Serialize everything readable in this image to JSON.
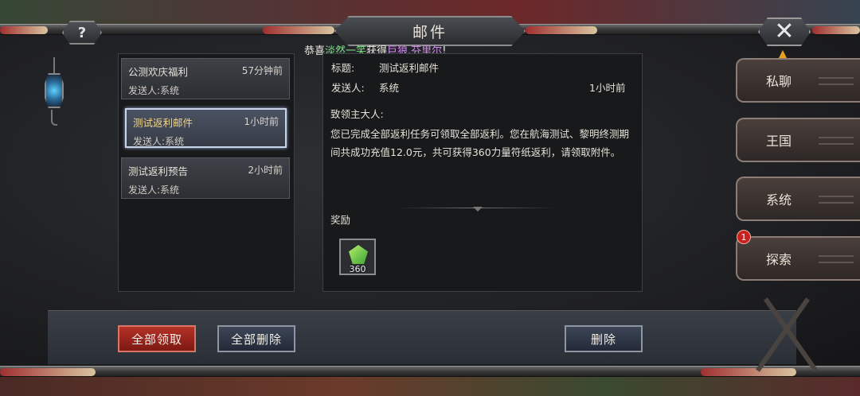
{
  "window": {
    "title": "邮件",
    "help_label": "?",
    "close_label": "✕"
  },
  "announcement": {
    "prefix": "恭喜",
    "player": "淡然一笑",
    "middle": "获得",
    "item": "巨狼.芬里尔",
    "suffix": "!"
  },
  "mail_list": [
    {
      "title": "公测欢庆福利",
      "time": "57分钟前",
      "sender": "发送人:系统",
      "selected": false
    },
    {
      "title": "测试返利邮件",
      "time": "1小时前",
      "sender": "发送人:系统",
      "selected": true
    },
    {
      "title": "测试返利预告",
      "time": "2小时前",
      "sender": "发送人:系统",
      "selected": false
    }
  ],
  "detail": {
    "subject_label": "标题:",
    "subject": "测试返利邮件",
    "sender_label": "发送人:",
    "sender": "系统",
    "time": "1小时前",
    "greeting": "致领主大人:",
    "body": "您已完成全部返利任务可领取全部返利。您在航海测试、黎明终测期间共成功充值12.0元，共可获得360力量符纸返利，请领取附件。",
    "reward_label": "奖励",
    "reward": {
      "icon": "talisman-icon",
      "quantity": "360"
    }
  },
  "side_tabs": [
    {
      "label": "私聊"
    },
    {
      "label": "王国"
    },
    {
      "label": "系统"
    },
    {
      "label": "探索",
      "badge": "1"
    }
  ],
  "buttons": {
    "claim_all": "全部领取",
    "delete_all": "全部删除",
    "delete": "删除"
  },
  "colors": {
    "highlight_player": "#7fe08a",
    "highlight_item": "#d48cf0",
    "selected_title": "#f2d38a",
    "primary_button": "#b53127",
    "badge": "#c7201d",
    "warning": "#e5a21e"
  }
}
